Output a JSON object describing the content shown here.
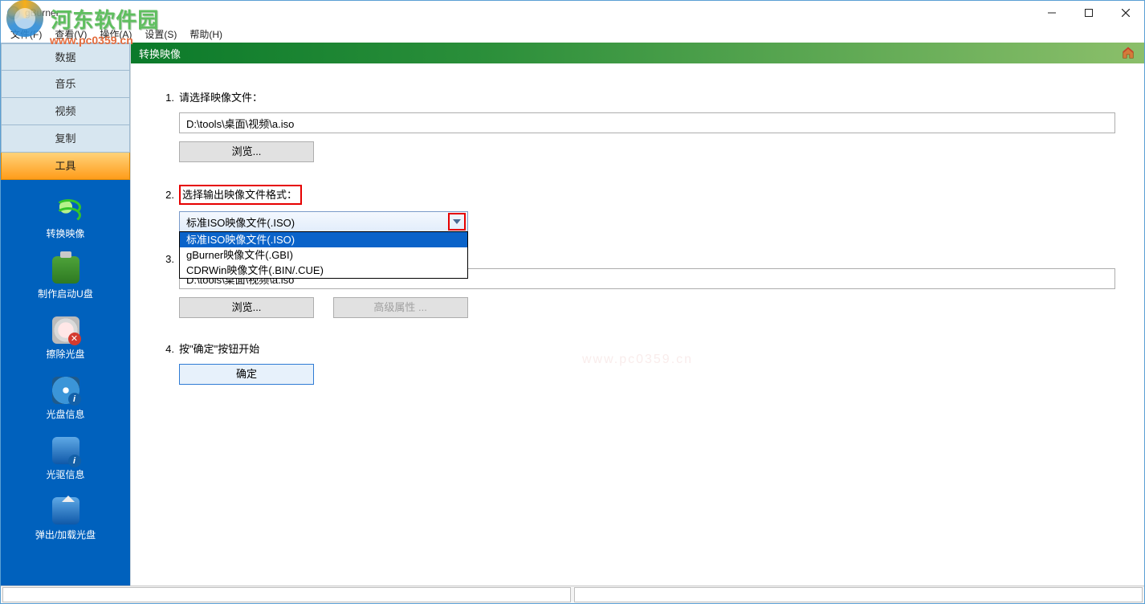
{
  "watermark": {
    "text": "河东软件园",
    "url": "www.pc0359.cn"
  },
  "center_watermark": "www.pc0359.cn",
  "title": "gBurner",
  "menu": [
    "文件(F)",
    "查看(V)",
    "操作(A)",
    "设置(S)",
    "帮助(H)"
  ],
  "sidebar": {
    "tabs": [
      {
        "label": "数据",
        "active": false
      },
      {
        "label": "音乐",
        "active": false
      },
      {
        "label": "视频",
        "active": false
      },
      {
        "label": "复制",
        "active": false
      },
      {
        "label": "工具",
        "active": true
      }
    ],
    "items": [
      "转换映像",
      "制作启动U盘",
      "擦除光盘",
      "光盘信息",
      "光驱信息",
      "弹出/加载光盘"
    ]
  },
  "header": "转换映像",
  "step1": {
    "num": "1.",
    "label": "请选择映像文件：",
    "path": "D:\\tools\\桌面\\视频\\a.iso",
    "browse": "浏览..."
  },
  "step2": {
    "num": "2.",
    "label": "选择输出映像文件格式：",
    "selected": "标准ISO映像文件(.ISO)",
    "options": [
      "标准ISO映像文件(.ISO)",
      "gBurner映像文件(.GBI)",
      "CDRWin映像文件(.BIN/.CUE)"
    ]
  },
  "step3": {
    "num": "3.",
    "path": "D:\\tools\\桌面\\视频\\a.iso",
    "browse": "浏览...",
    "advanced": "高级属性 ..."
  },
  "step4": {
    "num": "4.",
    "label": "按\"确定\"按钮开始",
    "ok": "确定"
  }
}
